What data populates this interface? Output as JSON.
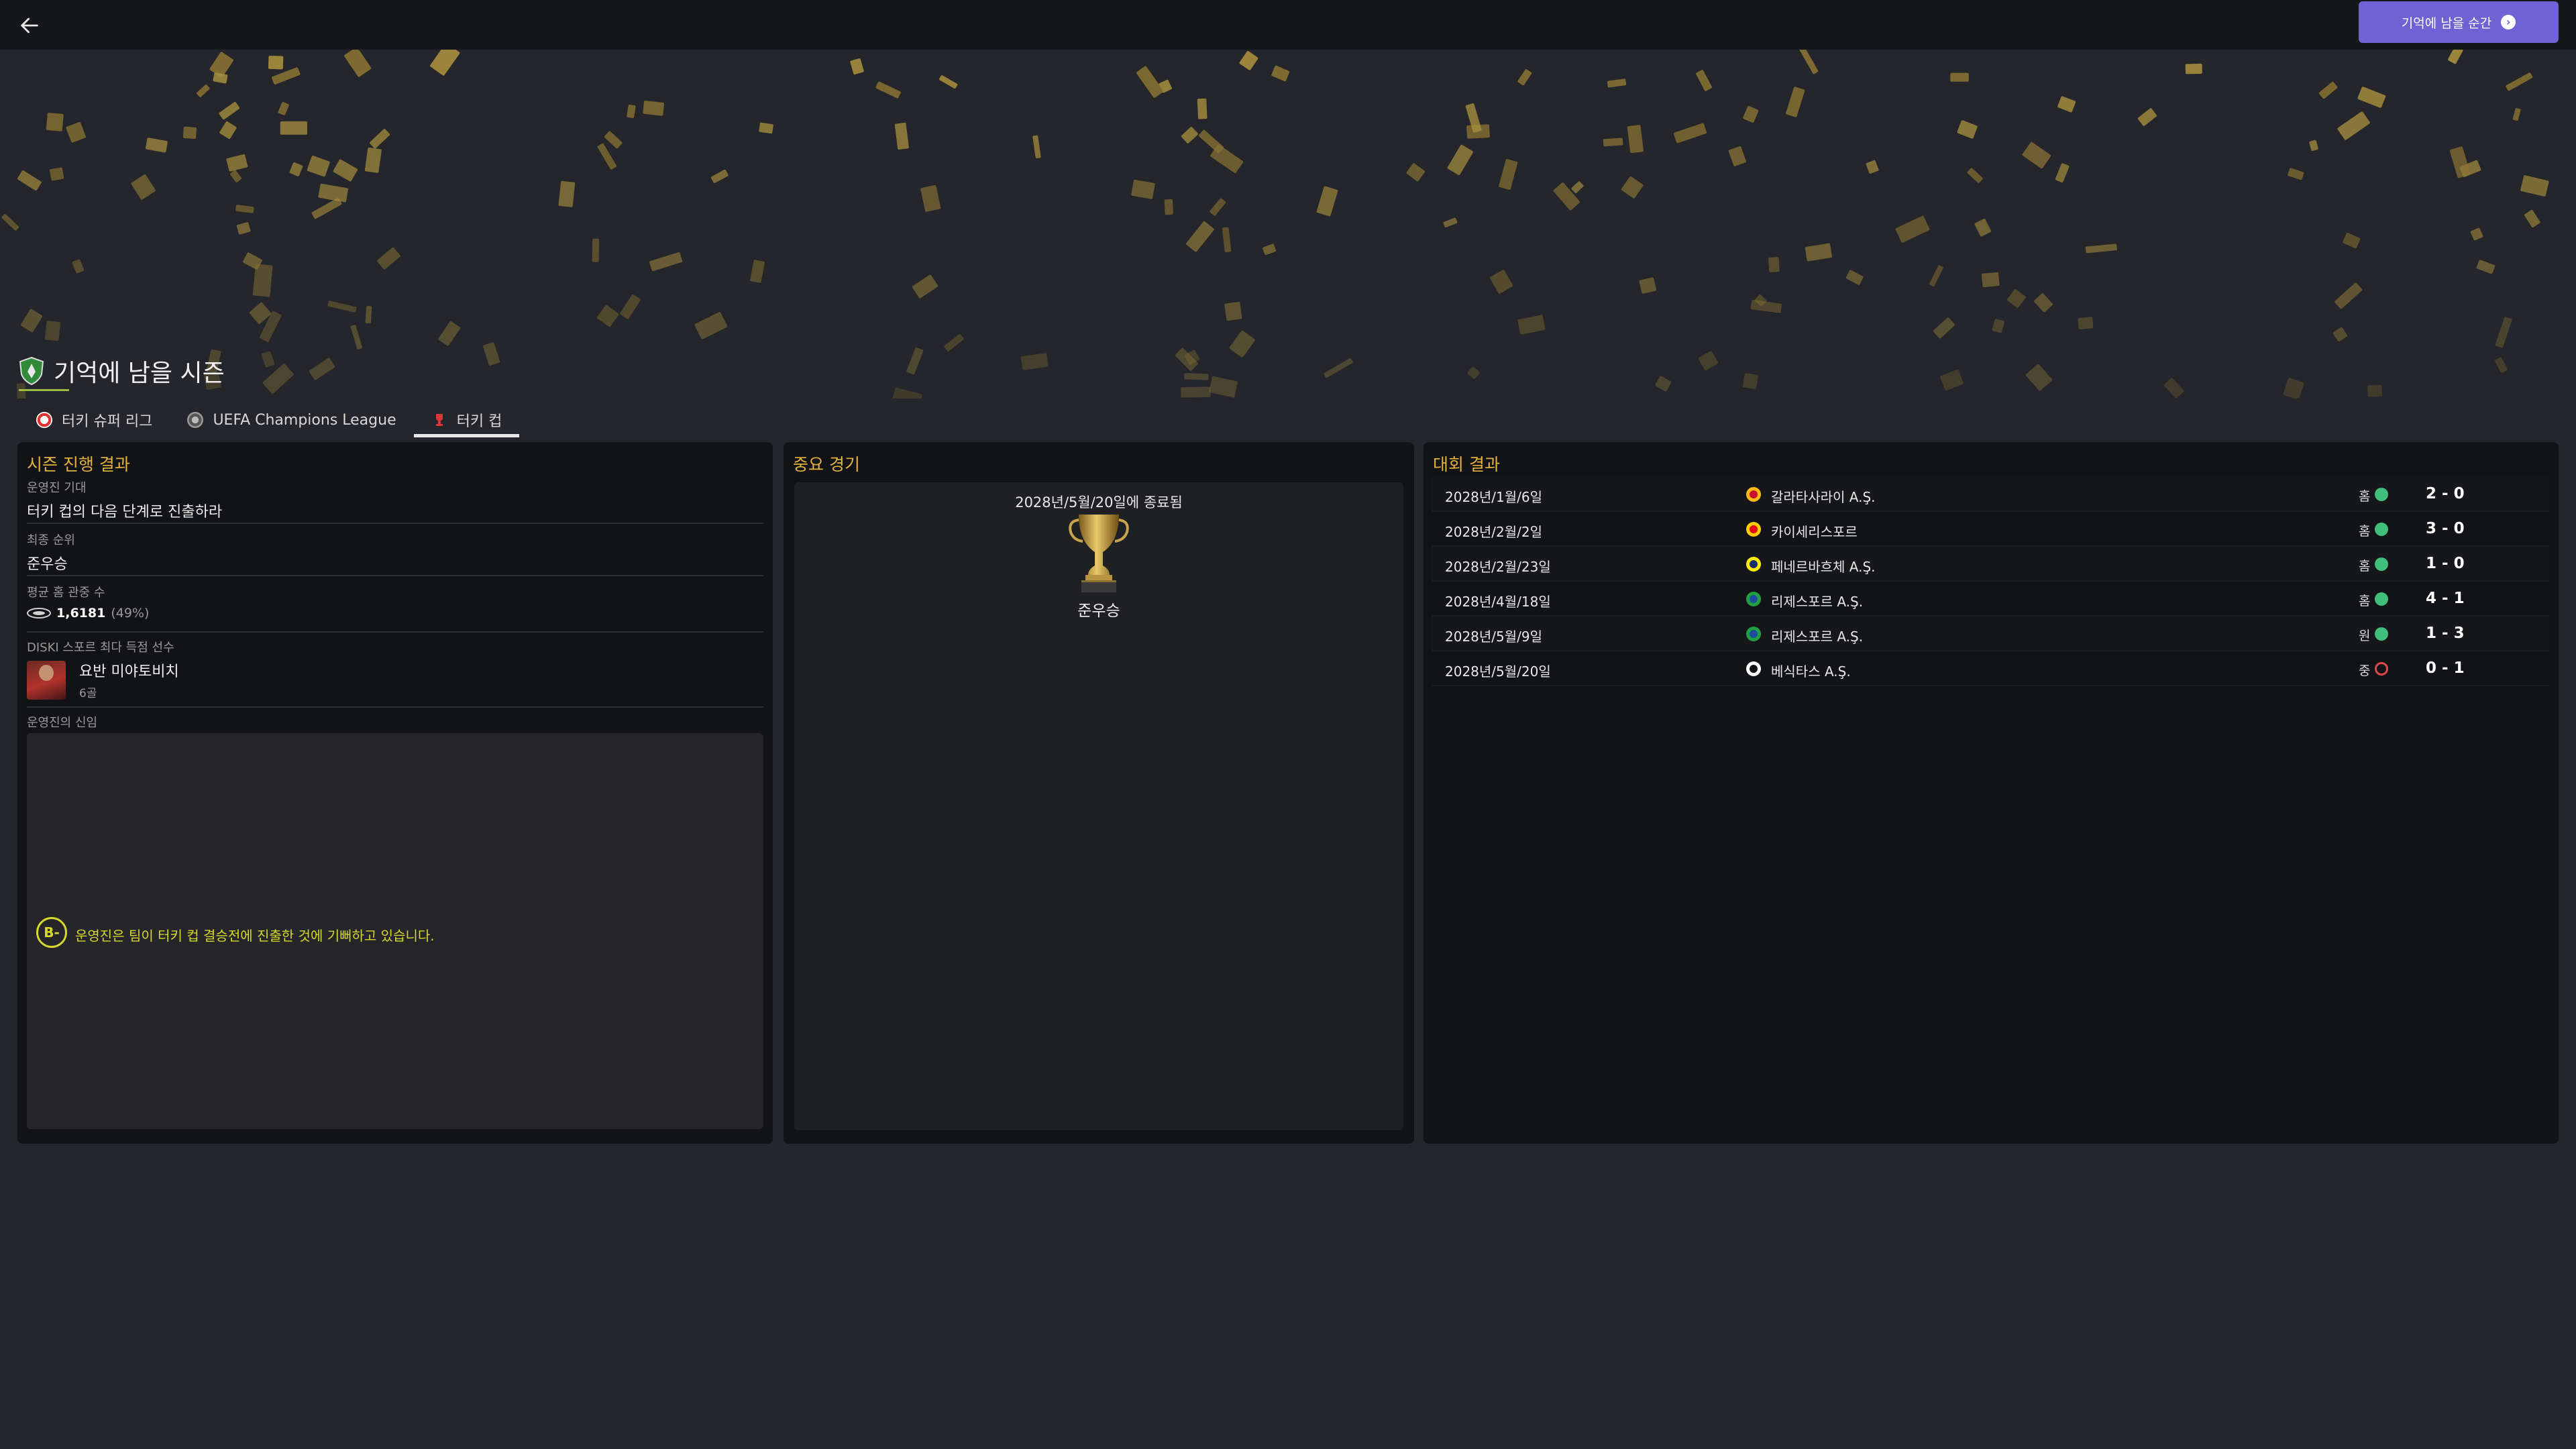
{
  "header": {
    "back_icon": "arrow-left-icon",
    "memorable_moments_label": "기억에 남을 순간"
  },
  "page": {
    "title": "기억에 남을 시즌",
    "tabs": [
      {
        "label": "터키 슈퍼 리그",
        "icon": "super-lig-icon"
      },
      {
        "label": "UEFA Champions League",
        "icon": "ucl-icon"
      },
      {
        "label": "터키 컵",
        "icon": "turkish-cup-icon",
        "active": true
      }
    ]
  },
  "season_results": {
    "title": "시즌 진행 결과",
    "expectation_label": "운영진 기대",
    "expectation_value": "터키 컵의 다음 단계로 진출하라",
    "final_position_label": "최종 순위",
    "final_position_value": "준우승",
    "avg_attendance_label": "평균 홈 관중 수",
    "avg_attendance_value": "1,6181",
    "avg_attendance_pct": "(49%)",
    "top_scorer_label": "DISKI 스포르 최다 득점 선수",
    "top_scorer_name": "요반 미야토비치",
    "top_scorer_goals": "6골",
    "board_confidence_label": "운영진의 신임",
    "board_grade": "B-",
    "board_text": "운영진은 팀이 터키 컵 결승전에 진출한 것에 기뻐하고 있습니다."
  },
  "key_match": {
    "title": "중요 경기",
    "ended_text": "2028년/5월/20일에 종료됨",
    "result": "준우승"
  },
  "competition_results": {
    "title": "대회 결과",
    "rows": [
      {
        "date": "2028년/1월/6일",
        "team": "갈라타사라이 A.Ş.",
        "venue": "홈",
        "outcome": "win",
        "score": "2 - 0"
      },
      {
        "date": "2028년/2월/2일",
        "team": "카이세리스포르",
        "venue": "홈",
        "outcome": "win",
        "score": "3 - 0"
      },
      {
        "date": "2028년/2월/23일",
        "team": "페네르바흐체 A.Ş.",
        "venue": "홈",
        "outcome": "win",
        "score": "1 - 0"
      },
      {
        "date": "2028년/4월/18일",
        "team": "리제스포르 A.Ş.",
        "venue": "홈",
        "outcome": "win",
        "score": "4 - 1"
      },
      {
        "date": "2028년/5월/9일",
        "team": "리제스포르 A.Ş.",
        "venue": "원",
        "outcome": "win",
        "score": "1 - 3"
      },
      {
        "date": "2028년/5월/20일",
        "team": "베식타스 A.Ş.",
        "venue": "중",
        "outcome": "loss",
        "score": "0 - 1"
      }
    ]
  },
  "colors": {
    "accent_gold": "#e3b13e",
    "button_purple": "#6e62d4",
    "win_green": "#3fbf7a",
    "loss_red": "#e0474c",
    "board_yellow": "#d6d92b"
  }
}
